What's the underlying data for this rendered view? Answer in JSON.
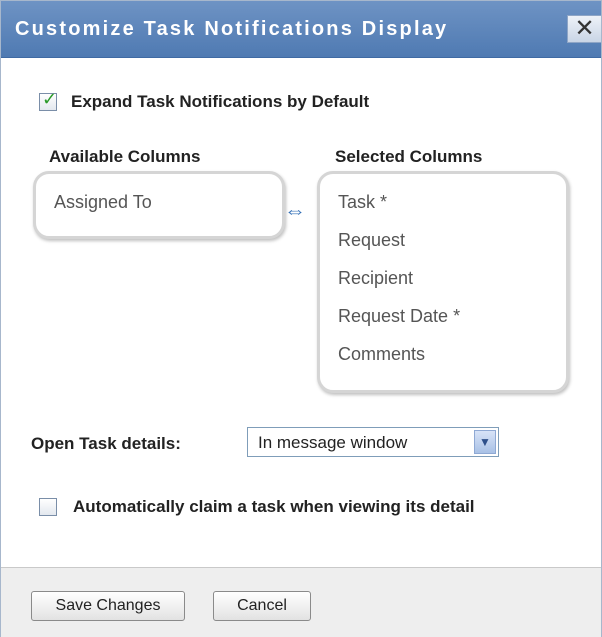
{
  "dialog": {
    "title": "Customize Task Notifications Display",
    "close_glyph": "✕"
  },
  "expand_default": {
    "label": "Expand Task Notifications by Default",
    "checked": true
  },
  "columns": {
    "available_heading": "Available Columns",
    "selected_heading": "Selected Columns",
    "available": [
      "Assigned To"
    ],
    "selected": [
      "Task *",
      "Request",
      "Recipient",
      "Request Date *",
      "Comments"
    ],
    "swap_glyph": "⇔"
  },
  "open_details": {
    "label": "Open Task details:",
    "value": "In message window"
  },
  "auto_claim": {
    "label": "Automatically claim a task when viewing its detail",
    "checked": false
  },
  "footer": {
    "save_label": "Save Changes",
    "cancel_label": "Cancel"
  },
  "colors": {
    "titlebar": "#5b83b9",
    "title_text": "#ffffff",
    "checkmark": "#2a9a2a",
    "swap_icon": "#2f6db5",
    "footer_bg": "#eeeeee"
  },
  "icons": [
    "close-icon",
    "checkmark-icon",
    "swap-arrows-icon",
    "chevron-down-icon"
  ]
}
